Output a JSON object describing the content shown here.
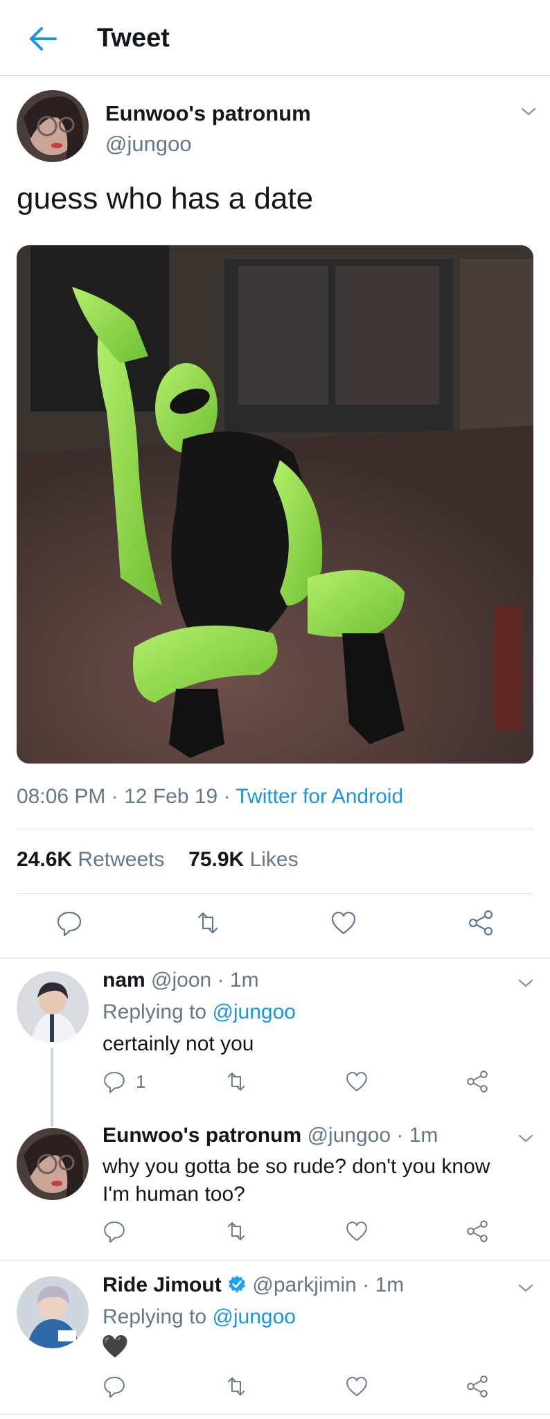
{
  "header": {
    "title": "Tweet"
  },
  "main_tweet": {
    "display_name": "Eunwoo's patronum",
    "handle": "@jungoo",
    "text": "guess who has a date",
    "time": "08:06 PM",
    "date": "12 Feb 19",
    "source": "Twitter for Android",
    "retweets_count": "24.6K",
    "retweets_label": "Retweets",
    "likes_count": "75.9K",
    "likes_label": "Likes"
  },
  "replies": [
    {
      "display_name": "nam",
      "handle": "@joon",
      "time": "1m",
      "replying_label": "Replying to",
      "replying_handle": "@jungoo",
      "text": "certainly not you",
      "reply_count": "1"
    },
    {
      "display_name": "Eunwoo's patronum",
      "handle": "@jungoo",
      "time": "1m",
      "text_line1": "why you gotta be so rude? don't you know",
      "text_line2": "I'm human too?"
    },
    {
      "display_name": "Ride Jimout",
      "handle": "@parkjimin",
      "time": "1m",
      "replying_label": "Replying to",
      "replying_handle": "@jungoo",
      "text": "🖤",
      "verified": true
    }
  ],
  "separator": "·",
  "colors": {
    "accent": "#1b95e0",
    "muted": "#657786",
    "divider": "#e1e8ed",
    "alien_green": "#8ed64a"
  }
}
